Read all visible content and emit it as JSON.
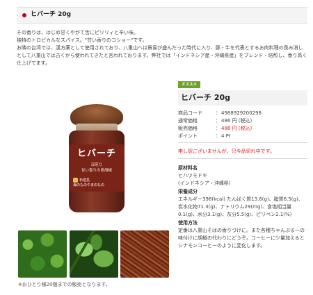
{
  "header": {
    "title": "ヒバーチ 20g"
  },
  "description": [
    "その香りは、はじめ甘くやがて舌にピリリィと辛い味。",
    "独特のトロピカルなスパイス。\"甘い香りのコショー\"です。",
    "お隣の台湾では、漢方薬として使用されており、八重山へは貿易が盛んだった時代に入り、豚・牛を代表とするお肉料理の臭み消しとして八重山では古くから使われてきたと言われております。弊社では「インドネシア産・沖縄県産」をブレンド・焙煎し、香り高く仕上げてます。"
  ],
  "product_image": {
    "label_main": "ヒバーチ",
    "label_sub": "深煎り\n甘い香りの島胡椒",
    "label_brand": "石垣島\n海のものやまのもの"
  },
  "badge": "オススメ",
  "product_title": "ヒバーチ 20g",
  "info": [
    {
      "label": "商品コード",
      "value": "4988929200298",
      "highlight": false
    },
    {
      "label": "通常価格",
      "value": "486 円 (税込)",
      "highlight": false
    },
    {
      "label": "販売価格",
      "value": "486 円 (税込)",
      "highlight": true
    },
    {
      "label": "ポイント",
      "value": "4 Pt",
      "highlight": false
    }
  ],
  "soldout_message": "申し訳ございませんが、只今品切れ中です。",
  "details": {
    "ingredients_title": "原材料名",
    "ingredients": "ヒハツモドキ\n(インドネシア・沖縄県)",
    "nutrition_title": "栄養成分",
    "nutrition": "エネルギー398(kcal) たんぱく質13.6(g)、脂質6.5(g)、炭水化物71.3(g)、ナトリウム29(mg)、食塩相当量0.1(g)、水分3.1(g)、灰分5.5(g)、ピリペン2.1(%)",
    "usage_title": "使用方法",
    "usage": "定番は八重山そばの香りづけに。また各種ちゃんぷるーの味付けに胡椒の代わりにどうぞ。コーヒーに少量加えるとシナモンコーヒーのように変化します。"
  },
  "thumbs": [
    "leaves-photo",
    "fruit-photo",
    "dried-peppers-photo"
  ],
  "footnote": "※おひとり様20個までの販売となります。",
  "colors": {
    "accent_red": "#c1001f",
    "price_red": "#d32020",
    "badge_green": "#6aa526"
  }
}
